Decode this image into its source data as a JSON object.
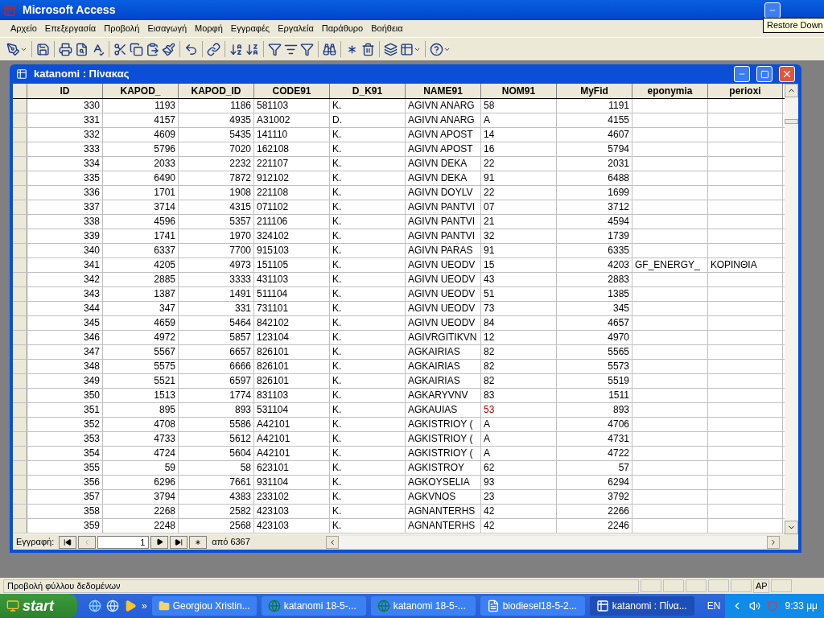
{
  "app": {
    "title": "Microsoft Access",
    "tooltip": "Restore Down"
  },
  "menu": [
    "Αρχείο",
    "Επεξεργασία",
    "Προβολή",
    "Εισαγωγή",
    "Μορφή",
    "Εγγραφές",
    "Εργαλεία",
    "Παράθυρο",
    "Βοήθεια"
  ],
  "table_window": {
    "title": "katanomi : Πίνακας",
    "columns": [
      {
        "label": "ID",
        "kind": "number"
      },
      {
        "label": "KAPOD_",
        "kind": "number"
      },
      {
        "label": "KAPOD_ID",
        "kind": "number"
      },
      {
        "label": "CODE91",
        "kind": "text"
      },
      {
        "label": "D_K91",
        "kind": "text"
      },
      {
        "label": "NAME91",
        "kind": "text"
      },
      {
        "label": "NOM91",
        "kind": "text"
      },
      {
        "label": "MyFid",
        "kind": "number"
      },
      {
        "label": "eponymia",
        "kind": "text"
      },
      {
        "label": "perioxi",
        "kind": "text"
      }
    ],
    "rows": [
      {
        "cells": [
          "330",
          "1193",
          "1186",
          "581103",
          "K.",
          "AGIVN ANARG",
          "58",
          "1191",
          "",
          ""
        ],
        "flagged": false
      },
      {
        "cells": [
          "331",
          "4157",
          "4935",
          "A31002",
          "D.",
          "AGIVN ANARG",
          "A",
          "4155",
          "",
          ""
        ],
        "flagged": false
      },
      {
        "cells": [
          "332",
          "4609",
          "5435",
          "141110",
          "K.",
          "AGIVN APOST",
          "14",
          "4607",
          "",
          ""
        ],
        "flagged": false
      },
      {
        "cells": [
          "333",
          "5796",
          "7020",
          "162108",
          "K.",
          "AGIVN APOST",
          "16",
          "5794",
          "",
          ""
        ],
        "flagged": false
      },
      {
        "cells": [
          "334",
          "2033",
          "2232",
          "221107",
          "K.",
          "AGIVN DEKA",
          "22",
          "2031",
          "",
          ""
        ],
        "flagged": false
      },
      {
        "cells": [
          "335",
          "6490",
          "7872",
          "912102",
          "K.",
          "AGIVN DEKA",
          "91",
          "6488",
          "",
          ""
        ],
        "flagged": false
      },
      {
        "cells": [
          "336",
          "1701",
          "1908",
          "221108",
          "K.",
          "AGIVN DOYLV",
          "22",
          "1699",
          "",
          ""
        ],
        "flagged": false
      },
      {
        "cells": [
          "337",
          "3714",
          "4315",
          "071102",
          "K.",
          "AGIVN PANTVI",
          "07",
          "3712",
          "",
          ""
        ],
        "flagged": false
      },
      {
        "cells": [
          "338",
          "4596",
          "5357",
          "211106",
          "K.",
          "AGIVN PANTVI",
          "21",
          "4594",
          "",
          ""
        ],
        "flagged": false
      },
      {
        "cells": [
          "339",
          "1741",
          "1970",
          "324102",
          "K.",
          "AGIVN PANTVI",
          "32",
          "1739",
          "",
          ""
        ],
        "flagged": false
      },
      {
        "cells": [
          "340",
          "6337",
          "7700",
          "915103",
          "K.",
          "AGIVN PARAS",
          "91",
          "6335",
          "",
          ""
        ],
        "flagged": false
      },
      {
        "cells": [
          "341",
          "4205",
          "4973",
          "151105",
          "K.",
          "AGIVN UEODV",
          "15",
          "4203",
          "GF_ENERGY_",
          "ΚΟΡΙΝΘΙΑ"
        ],
        "flagged": false
      },
      {
        "cells": [
          "342",
          "2885",
          "3333",
          "431103",
          "K.",
          "AGIVN UEODV",
          "43",
          "2883",
          "",
          ""
        ],
        "flagged": false
      },
      {
        "cells": [
          "343",
          "1387",
          "1491",
          "511104",
          "K.",
          "AGIVN UEODV",
          "51",
          "1385",
          "",
          ""
        ],
        "flagged": false
      },
      {
        "cells": [
          "344",
          "347",
          "331",
          "731101",
          "K.",
          "AGIVN UEODV",
          "73",
          "345",
          "",
          ""
        ],
        "flagged": false
      },
      {
        "cells": [
          "345",
          "4659",
          "5464",
          "842102",
          "K.",
          "AGIVN UEODV",
          "84",
          "4657",
          "",
          ""
        ],
        "flagged": false
      },
      {
        "cells": [
          "346",
          "4972",
          "5857",
          "123104",
          "K.",
          "AGIVRGITIKVN",
          "12",
          "4970",
          "",
          ""
        ],
        "flagged": false
      },
      {
        "cells": [
          "347",
          "5567",
          "6657",
          "826101",
          "K.",
          "AGKAIRIAS",
          "82",
          "5565",
          "",
          ""
        ],
        "flagged": false
      },
      {
        "cells": [
          "348",
          "5575",
          "6666",
          "826101",
          "K.",
          "AGKAIRIAS",
          "82",
          "5573",
          "",
          ""
        ],
        "flagged": false
      },
      {
        "cells": [
          "349",
          "5521",
          "6597",
          "826101",
          "K.",
          "AGKAIRIAS",
          "82",
          "5519",
          "",
          ""
        ],
        "flagged": false
      },
      {
        "cells": [
          "350",
          "1513",
          "1774",
          "831103",
          "K.",
          "AGKARYVNV",
          "83",
          "1511",
          "",
          ""
        ],
        "flagged": false
      },
      {
        "cells": [
          "351",
          "895",
          "893",
          "531104",
          "K.",
          "AGKAUIAS",
          "53",
          "893",
          "",
          ""
        ],
        "flagged": true
      },
      {
        "cells": [
          "352",
          "4708",
          "5586",
          "A42101",
          "K.",
          "AGKISTRIOY (",
          "A",
          "4706",
          "",
          ""
        ],
        "flagged": false
      },
      {
        "cells": [
          "353",
          "4733",
          "5612",
          "A42101",
          "K.",
          "AGKISTRIOY (",
          "A",
          "4731",
          "",
          ""
        ],
        "flagged": false
      },
      {
        "cells": [
          "354",
          "4724",
          "5604",
          "A42101",
          "K.",
          "AGKISTRIOY (",
          "A",
          "4722",
          "",
          ""
        ],
        "flagged": false
      },
      {
        "cells": [
          "355",
          "59",
          "58",
          "623101",
          "K.",
          "AGKISTROY",
          "62",
          "57",
          "",
          ""
        ],
        "flagged": false
      },
      {
        "cells": [
          "356",
          "6296",
          "7661",
          "931104",
          "K.",
          "AGKOYSELIA",
          "93",
          "6294",
          "",
          ""
        ],
        "flagged": false
      },
      {
        "cells": [
          "357",
          "3794",
          "4383",
          "233102",
          "K.",
          "AGKVNOS",
          "23",
          "3792",
          "",
          ""
        ],
        "flagged": false
      },
      {
        "cells": [
          "358",
          "2268",
          "2582",
          "423103",
          "K.",
          "AGNANTERHS",
          "42",
          "2266",
          "",
          ""
        ],
        "flagged": false
      },
      {
        "cells": [
          "359",
          "2248",
          "2568",
          "423103",
          "K.",
          "AGNANTERHS",
          "42",
          "2246",
          "",
          ""
        ],
        "flagged": false
      }
    ],
    "navigator": {
      "label": "Εγγραφή:",
      "record": "1",
      "total": "από 6367"
    }
  },
  "status_bar": {
    "text": "Προβολή φύλλου δεδομένων",
    "indicator": "AP"
  },
  "taskbar": {
    "start": "start",
    "more": "»",
    "tasks": [
      {
        "label": "Georgiou Xristin...",
        "kind": "folder",
        "selected": false
      },
      {
        "label": "katanomi 18-5-...",
        "kind": "globe",
        "selected": false
      },
      {
        "label": "katanomi 18-5-...",
        "kind": "globe",
        "selected": false
      },
      {
        "label": "biodiesel18-5-2...",
        "kind": "document",
        "selected": false
      },
      {
        "label": "katanomi : Πίνα...",
        "kind": "table",
        "selected": true
      }
    ],
    "language": "EN",
    "clock": "9:33 μμ"
  }
}
